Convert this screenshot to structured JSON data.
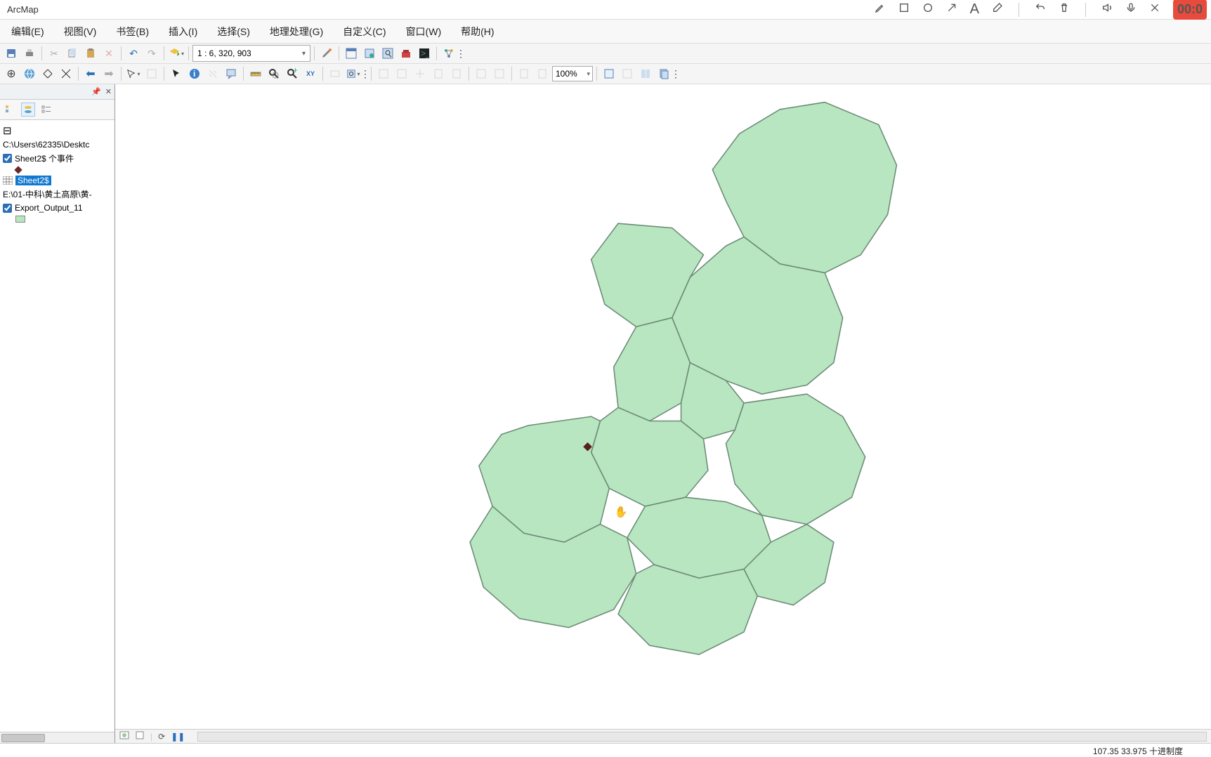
{
  "app": {
    "title": "ArcMap"
  },
  "titlebar_right": {
    "record": "00:0"
  },
  "menu": [
    "编辑(E)",
    "视图(V)",
    "书签(B)",
    "插入(I)",
    "选择(S)",
    "地理处理(G)",
    "自定义(C)",
    "窗口(W)",
    "帮助(H)"
  ],
  "toolbar1": {
    "scale": "1 : 6, 320, 903"
  },
  "toolbar2": {
    "zoom": "100%"
  },
  "toc": {
    "source1": "C:\\Users\\62335\\Desktc",
    "layer1": {
      "name": "Sheet2$ 个事件",
      "checked": true
    },
    "table1": "Sheet2$",
    "source2": "E:\\01-中科\\黄土高原\\黄-",
    "layer2": {
      "name": "Export_Output_11",
      "checked": true
    }
  },
  "map": {
    "fill": "#b8e6c1",
    "stroke": "#6a8a74",
    "point_color": "#5a1f1f"
  },
  "status": {
    "coords": "107.35  33.975 十进制度"
  }
}
